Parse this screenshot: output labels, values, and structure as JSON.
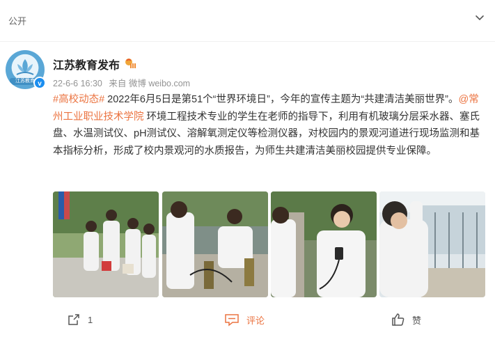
{
  "topbar": {
    "label": "公开"
  },
  "post": {
    "author": "江苏教育发布",
    "avatar_text": "江苏教育",
    "date": "22-6-6 16:30",
    "source": "来自 微博 weibo.com",
    "hashtag": "#高校动态#",
    "text_part1": " 2022年6月5日是第51个“世界环境日”，今年的宣传主题为“共建清洁美丽世界”。",
    "mention": "@常州工业职业技术学院",
    "text_part2": " 环境工程技术专业的学生在老师的指导下，利用有机玻璃分层采水器、塞氏盘、水温测试仪、pH测试仪、溶解氧测定仪等检测仪器，对校园内的景观河道进行现场监测和基本指标分析，形成了校内景观河的水质报告，为师生共建清洁美丽校园提供专业保障。"
  },
  "actions": {
    "repost_count": "1",
    "comment_label": "评论",
    "like_label": "赞"
  },
  "colors": {
    "link": "#eb7340",
    "verified": "#1b8ef0",
    "meta": "#939393"
  }
}
